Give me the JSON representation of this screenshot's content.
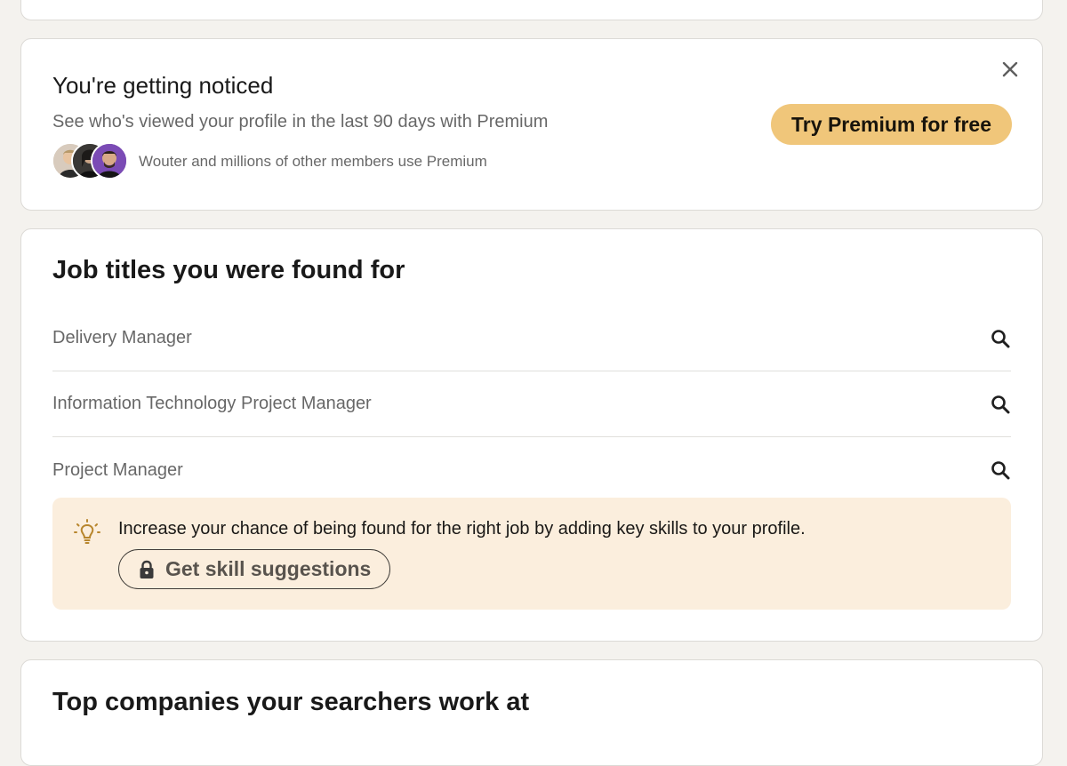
{
  "premium_card": {
    "title": "You're getting noticed",
    "subtitle": "See who's viewed your profile in the last 90 days with Premium",
    "cta_label": "Try Premium for free",
    "members_text": "Wouter and millions of other members use Premium",
    "cta_color": "#f0c67a"
  },
  "jobs_card": {
    "title": "Job titles you were found for",
    "job_titles": [
      "Delivery Manager",
      "Information Technology Project Manager",
      "Project Manager"
    ],
    "tip": {
      "text": "Increase your chance of being found for the right job by adding key skills to your profile.",
      "button_label": "Get skill suggestions",
      "background": "#fbeedd"
    }
  },
  "companies_card": {
    "title": "Top companies your searchers work at"
  },
  "icons": {
    "close": "close-icon",
    "search": "search-icon",
    "tip": "lightbulb-icon",
    "lock": "lock-icon"
  }
}
